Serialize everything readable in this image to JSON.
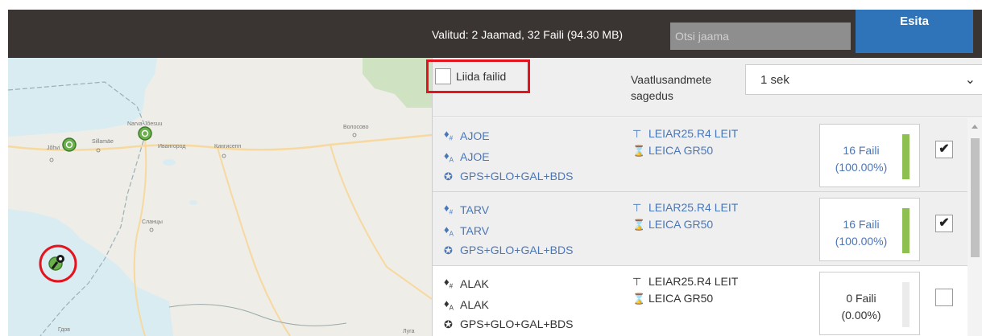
{
  "topbar": {
    "summary": "Valitud:  2 Jaamad, 32 Faili (94.30 MB)",
    "search_placeholder": "Otsi jaama",
    "submit_label": "Esita"
  },
  "map": {
    "labels": [
      "Narva-Jõesuu",
      "Sillamäe",
      "Jõhvi",
      "Ивангород",
      "Кингисепп",
      "Волосово",
      "Сланцы",
      "Гдов",
      "Луга"
    ]
  },
  "options": {
    "merge_label": "Liida failid",
    "merge_checked": false,
    "frequency_label": "Vaatlusandmete sagedus",
    "frequency_value": "1 sek"
  },
  "stations": [
    {
      "name": "AJOE",
      "marker": "AJOE",
      "constellations": "GPS+GLO+GAL+BDS",
      "antenna": "LEIAR25.R4 LEIT",
      "receiver": "LEICA GR50",
      "files_label": "16 Faili",
      "percent_label": "(100.00%)",
      "fraction": 1.0,
      "selected": true,
      "check_mark": "✔"
    },
    {
      "name": "TARV",
      "marker": "TARV",
      "constellations": "GPS+GLO+GAL+BDS",
      "antenna": "LEIAR25.R4 LEIT",
      "receiver": "LEICA GR50",
      "files_label": "16 Faili",
      "percent_label": "(100.00%)",
      "fraction": 1.0,
      "selected": true,
      "check_mark": "✔"
    },
    {
      "name": "ALAK",
      "marker": "ALAK",
      "constellations": "GPS+GLO+GAL+BDS",
      "antenna": "LEIAR25.R4 LEIT",
      "receiver": "LEICA GR50",
      "files_label": "0 Faili",
      "percent_label": "(0.00%)",
      "fraction": 0.0,
      "selected": false,
      "check_mark": ""
    }
  ],
  "icons": {
    "name": "station-tag-icon",
    "marker": "marker-tag-icon",
    "constellations": "satellite-icon",
    "antenna": "antenna-icon",
    "receiver": "receiver-icon",
    "dropdown": "chevron-down-icon"
  },
  "colors": {
    "topbar": "#3a3532",
    "accent": "#2f73b8",
    "highlight": "#e5131d",
    "progress": "#8dc050",
    "link": "#4a77b8"
  }
}
